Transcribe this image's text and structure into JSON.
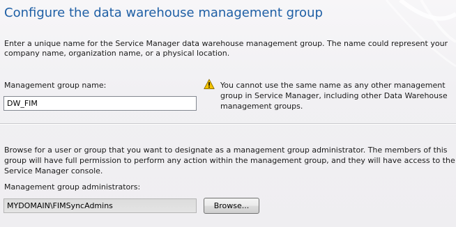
{
  "page": {
    "title": "Configure the data warehouse management group",
    "intro_line1": "Enter a unique name for the Service Manager data warehouse management group. The name could represent your",
    "intro_line2": "company name, organization name, or a physical location."
  },
  "group_name": {
    "label": "Management group name:",
    "value": "DW_FIM"
  },
  "warning": {
    "icon": "warning-icon",
    "line1": "You cannot use the same name as any other management",
    "line2": "group in Service Manager, including other Data Warehouse",
    "line3": "management groups."
  },
  "admins_section": {
    "description_line1": "Browse for a user or group that you want to designate as a management group administrator. The members of this",
    "description_line2": "group will have full permission to perform any action within the management group, and they will have access to the",
    "description_line3": "Service Manager console.",
    "label": "Management group administrators:",
    "value": "MYDOMAIN\\FIMSyncAdmins",
    "browse_label": "Browse..."
  },
  "colors": {
    "title": "#1e5fa5",
    "background": "#f1f0f3",
    "warning_yellow": "#f5c400"
  }
}
